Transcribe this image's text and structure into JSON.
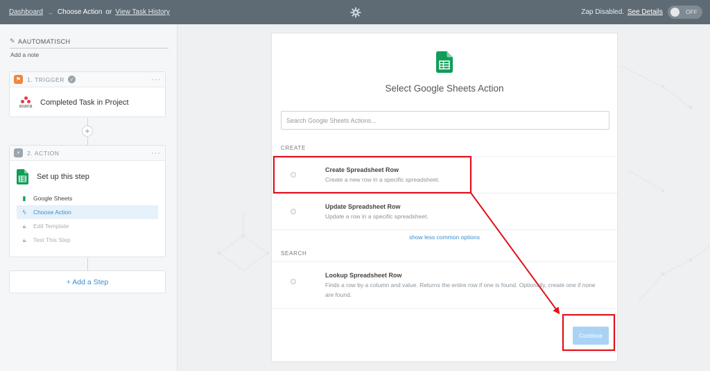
{
  "topbar": {
    "dashboard": "Dashboard",
    "arrow": "→",
    "current": "Choose Action",
    "or": "or",
    "history": "View Task History",
    "status": "Zap Disabled.",
    "details": "See Details",
    "toggle": "OFF",
    "gear_icon": "gear-icon"
  },
  "sidebar": {
    "zap_name": "AAUTOMATISCH",
    "add_note": "Add a note",
    "trigger": {
      "label": "1. TRIGGER",
      "app": "asana",
      "title": "Completed Task in Project"
    },
    "action": {
      "label": "2. ACTION",
      "title": "Set up this step",
      "steps": [
        {
          "label": "Google Sheets",
          "state": "done"
        },
        {
          "label": "Choose Action",
          "state": "active"
        },
        {
          "label": "Edit Template",
          "state": "locked"
        },
        {
          "label": "Test This Step",
          "state": "locked"
        }
      ]
    },
    "add_step": "+ Add a Step"
  },
  "panel": {
    "title": "Select Google Sheets Action",
    "search_placeholder": "Search Google Sheets Actions...",
    "create_label": "CREATE",
    "search_label": "SEARCH",
    "options": [
      {
        "title": "Create Spreadsheet Row",
        "desc": "Create a new row in a specific spreadsheet."
      },
      {
        "title": "Update Spreadsheet Row",
        "desc": "Update a row in a specific spreadsheet."
      },
      {
        "title": "Lookup Spreadsheet Row",
        "desc": "Finds a row by a column and value. Returns the entire row if one is found. Optionally, create one if none are found."
      }
    ],
    "less_options": "show less common options",
    "continue": "Continue"
  },
  "colors": {
    "topbar": "#5f6b74",
    "link": "#3a8ed0",
    "sheets_green": "#0f9d58",
    "annotation_red": "#e0101a"
  }
}
